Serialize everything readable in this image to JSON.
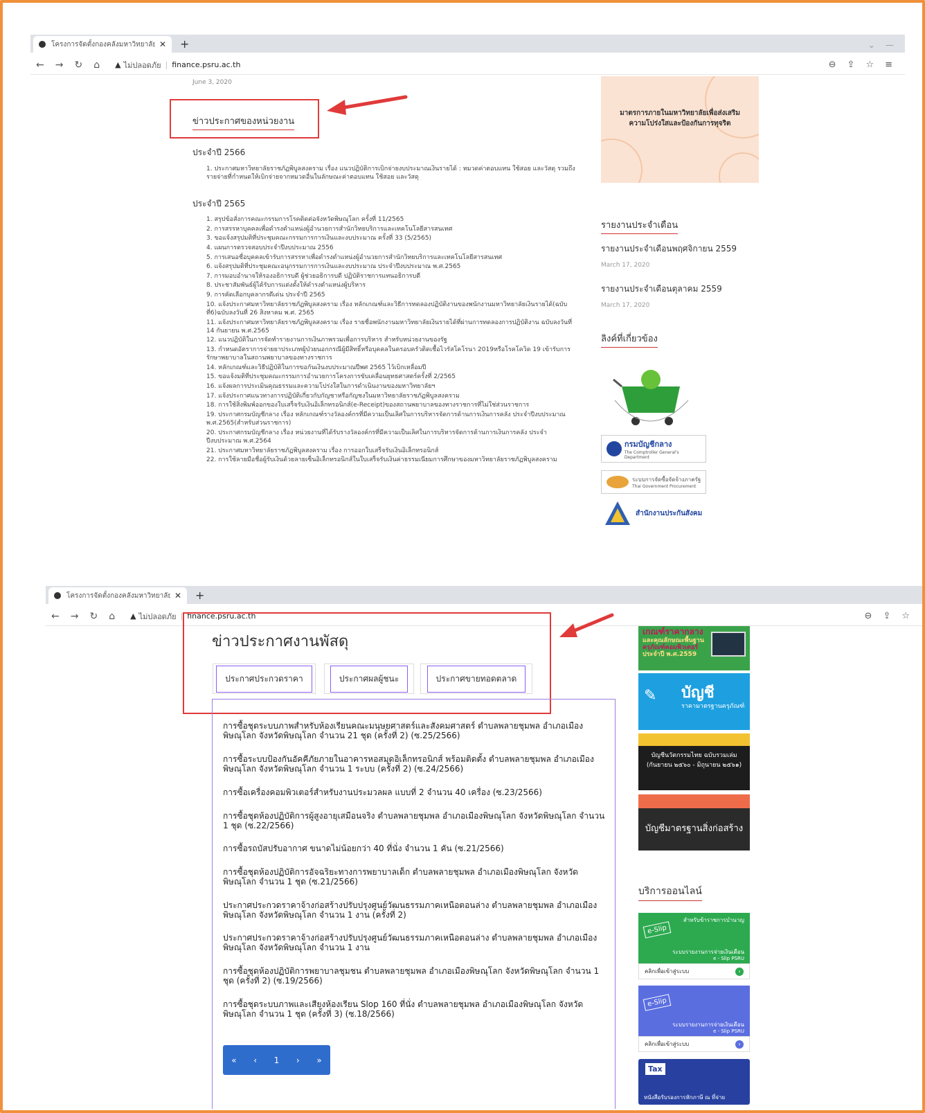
{
  "browser1": {
    "tab_title": "โครงการจัดตั้งกองคลังมหาวิทยาลัยราช",
    "insecure_label": "ไม่ปลอดภัย",
    "url": "finance.psru.ac.th"
  },
  "browser2": {
    "tab_title": "โครงการจัดตั้งกองคลังมหาวิทยาลัยราช",
    "insecure_label": "ไม่ปลอดภัย",
    "url": "finance.psru.ac.th"
  },
  "shot1": {
    "date": "June 3, 2020",
    "heading": "ข่าวประกาศของหน่วยงาน",
    "year_2566": "ประจำปี 2566",
    "list_2566": [
      "1. ประกาศมหาวิทยาลัยราชภัฏพิบูลสงคราม เรื่อง แนวปฏิบัติการเบิกจ่ายงบประมาณเงินรายได้ : หมวดค่าตอบแทน ใช้สอย และวัสดุ รวมถึงรายจ่ายที่กำหนดให้เบิกจ่ายจากหมวดอื่นในลักษณะค่าตอบแทน ใช้สอย และวัสดุ"
    ],
    "year_2565": "ประจำปี 2565",
    "list_2565": [
      "1. สรุปข้อสั่งการคณะกรรมการโรคติดต่อจังหวัดพิษณุโลก ครั้งที่ 11/2565",
      "2. การสรรหาบุคคลเพื่อดำรงตำแหน่งผู้อำนวยการสำนักวิทยบริการและเทคโนโลยีสารสนเทศ",
      "3. ขอแจ้งสรุปมติที่ประชุมคณะกรรมการการเงินและงบประมาณ ครั้งที่ 33 (5/2565)",
      "4. แผนการตรวจสอบประจำปีงบประมาณ 2556",
      "5. การเสนอชื่อบุคคลเข้ารับการสรรหาเพื่อดำรงตำแหน่งผู้อำนวยการสำนักวิทยบริการและเทคโนโลยีสารสนเทศ",
      "6. แจ้งสรุปมติที่ประชุมคณะอนุกรรมการการเงินและงบประมาณ ประจำปีงบประมาณ พ.ศ.2565",
      "7. การมอบอำนาจให้รองอธิการบดี ผู้ช่วยอธิการบดี ปฏิบัติราชการแทนอธิการบดี",
      "8. ประชาสัมพันธ์ผู้ได้รับการแต่งตั้งให้ดำรงตำแหน่งผู้บริหาร",
      "9. การคัดเลือกบุคลากรดีเด่น ประจำปี 2565",
      "10. แจ้งประกาศมหาวิทยาลัยราชภัฏพิบูลสงคราม เรื่อง หลักเกณฑ์และวิธีการทดลองปฏิบัติงานของพนักงานมหาวิทยาลัยเงินรายได้(ฉบับที่6)ฉบับลงวันที่ 26 สิงหาคม พ.ศ. 2565",
      "11. แจ้งประกาศมหาวิทยาลัยราชภัฏพิบูลสงคราม เรื่อง รายชื่อพนักงานมหาวิทยาลัยเงินรายได้ที่ผ่านการทดลองการปฏิบัติงาน ฉบับลงวันที่ 14 กันยายน พ.ศ.2565",
      "12. แนวปฏิบัติในการจัดทำรายงานการเงินภาพรวมเพื่อการบริหาร สำหรับหน่วยงานของรัฐ",
      "13. กำหนดอัตราการจ่ายยาประเภทผู้ป่วยนอกกรณีผู้มีสิทธิ์หรือบุคคลในครอบครัวติดเชื้อไวรัสโคโรนา 2019หรือโรคโควิด 19 เข้ารับการรักษาพยาบาลในสถานพยาบาลของทางราชการ",
      "14. หลักเกณฑ์และวิธีปฏิบัติในการขอกันเงินงบประมาณปีพศ 2565 ไว้เบิกเหลื่อมปี",
      "15. ขอแจ้งมติที่ประชุมคณะกรรมการอำนวยการโครงการขับเคลื่อนยุทธศาสตร์ครั้งที่ 2/2565",
      "16. แจ้งผลการประเมินคุณธรรมและความโปร่งใสในการดำเนินงานของมหาวิทยาลัยฯ",
      "17. แจ้งประกาศแนวทางการปฏิบัติเกี่ยวกับกัญชาหรือกัญชงในมหาวิทยาลัยราชภัฏพิบูลสงคราม",
      "18. การใช้สิ่งพิมพ์ออกของใบเสร็จรับเงินอิเล็กทรอนิกส์(e-Receipt)ของสถานพยาบาลของทางราชการที่ไม่ใช่ส่วนราชการ",
      "19. ประกาศกรมบัญชีกลาง เรื่อง หลักเกณฑ์รางวัลองค์กรที่มีความเป็นเลิศในการบริหารจัดการด้านการเงินการคลัง ประจำปีงบประมาณ พ.ศ.2565(สำหรับส่วนราชการ)",
      "20. ประกาศกรมบัญชีกลาง เรื่อง หน่วยงานที่ได้รับรางวัลองค์กรที่มีความเป็นเลิศในการบริหารจัดการด้านการเงินการคลัง ประจำปีงบประมาณ พ.ศ.2564",
      "21. ประกาศมหาวิทยาลัยราชภัฏพิบูลสงคราม เรื่อง การออกใบเสร็จรับเงินอิเล็กทรอนิกส์",
      "22. การใช้ลายมือชื่อผู้รับเงินด้วยลายเซ็นอิเล็กทรอนิกส์ในใบเสร็จรับเงินค่าธรรมเนียมการศึกษาของมหาวิทยาลัยราชภัฏพิบูลสงคราม"
    ],
    "side": {
      "banner_text_1": "มาตรการภายในมหาวิทยาลัยเพื่อส่งเสริม",
      "banner_text_2": "ความโปร่งใสและป้องกันการทุจริต",
      "monthly_heading": "รายงานประจำเดือน",
      "report1": "รายงานประจำเดือนพฤศจิกายน 2559",
      "report1_date": "March 17, 2020",
      "report2": "รายงานประจำเดือนตุลาคม 2559",
      "report2_date": "March 17, 2020",
      "links_heading": "ลิงค์ที่เกี่ยวข้อง",
      "cgd_name": "กรมบัญชีกลาง",
      "cgd_sub": "The Comptroller General's Department",
      "gprocure_name": "ระบบการจัดซื้อจัดจ้างภาครัฐ",
      "gprocure_sub": "Thai Government Procurement",
      "sso_name": "สำนักงานประกันสังคม"
    }
  },
  "shot2": {
    "title": "ข่าวประกาศงานพัสดุ",
    "tabs": [
      "ประกาศประกวดราคา",
      "ประกาศผลผู้ชนะ",
      "ประกาศขายทอดตลาด"
    ],
    "items": [
      "การซื้อชุดระบบภาพสำหรับห้องเรียนคณะมนุษยศาสตร์และสังคมศาสตร์ ตำบลพลายชุมพล อำเภอเมืองพิษณุโลก จังหวัดพิษณุโลก จำนวน 21 ชุด (ครั้งที่ 2) (ซ.25/2566)",
      "การซื้อระบบป้องกันอัคคีภัยภายในอาคารหอสมุดอิเล็กทรอนิกส์ พร้อมติดตั้ง ตำบลพลายชุมพล อำเภอเมืองพิษณุโลก จังหวัดพิษณุโลก จำนวน 1 ระบบ (ครั้งที่ 2) (ซ.24/2566)",
      "การซื้อเครื่องคอมพิวเตอร์สำหรับงานประมวลผล แบบที่ 2 จำนวน 40 เครื่อง (ซ.23/2566)",
      "การซื้อชุดห้องปฏิบัติการผู้สูงอายุเสมือนจริง ตำบลพลายชุมพล อำเภอเมืองพิษณุโลก จังหวัดพิษณุโลก จำนวน 1 ชุด (ซ.22/2566)",
      "การซื้อรถบัสปรับอากาศ ขนาดไม่น้อยกว่า 40 ที่นั่ง จำนวน 1 คัน (ซ.21/2566)",
      "การซื้อชุดห้องปฏิบัติการอัจฉริยะทางการพยาบาลเด็ก ตำบลพลายชุมพล อำเภอเมืองพิษณุโลก จังหวัดพิษณุโลก จำนวน 1 ชุด (ซ.21/2566)",
      "ประกาศประกวดราคาจ้างก่อสร้างปรับปรุงศูนย์วัฒนธรรมภาคเหนือตอนล่าง ตำบลพลายชุมพล อำเภอเมืองพิษณุโลก จังหวัดพิษณุโลก จำนวน 1 งาน (ครั้งที่ 2)",
      "ประกาศประกวดราคาจ้างก่อสร้างปรับปรุงศูนย์วัฒนธรรมภาคเหนือตอนล่าง ตำบลพลายชุมพล อำเภอเมืองพิษณุโลก จังหวัดพิษณุโลก จำนวน 1 งาน",
      "การซื้อชุดห้องปฏิบัติการพยาบาลชุมชน ตำบลพลายชุมพล อำเภอเมืองพิษณุโลก จังหวัดพิษณุโลก จำนวน 1 ชุด (ครั้งที่ 2) (ซ.19/2566)",
      "การซื้อชุดระบบภาพและเสียงห้องเรียน Slop 160 ที่นั่ง ตำบลพลายชุมพล อำเภอเมืองพิษณุโลก จังหวัดพิษณุโลก จำนวน 1 ชุด (ครั้งที่ 3) (ซ.18/2566)"
    ],
    "pager": [
      "«",
      "‹",
      "1",
      "›",
      "»"
    ],
    "side": {
      "banner1_line1": "เกณฑ์ราคากลาง",
      "banner1_line2": "และคุณลักษณะพื้นฐาน",
      "banner1_line3": "ครุภัณฑ์คอมพิวเตอร์",
      "banner1_line4": "ประจำปี พ.ศ.2559",
      "banner2_title": "บัญชี",
      "banner2_sub": "ราคามาตรฐานครุภัณฑ์",
      "banner3_line1": "บัญชีนวัตกรรมไทย ฉบับรวมเล่ม",
      "banner3_line2": "(กันยายน ๒๕๖๐ - มิถุนายน ๒๕๖๑)",
      "banner4": "บัญชีมาตรฐานสิ่งก่อสร้าง",
      "online_heading": "บริการออนไลน์",
      "slip1_top": "สำหรับข้าราชการบำนาญ",
      "slip_badge": "e-Slip",
      "slip_line1": "ระบบรายงานการจ่ายเงินเดือน",
      "slip_line2": "e - Slip PSRU",
      "slip_click": "คลิกเพื่อเข้าสู่ระบบ",
      "tax_badge": "Tax",
      "tax_text": "หนังสือรับรองการหักภาษี ณ ที่จ่าย"
    }
  },
  "colors": {
    "annotation_red": "#e03a3a",
    "accent_purple": "#8b5cf6",
    "pager_blue": "#2f6dcc",
    "frame_orange": "#f0903a"
  }
}
